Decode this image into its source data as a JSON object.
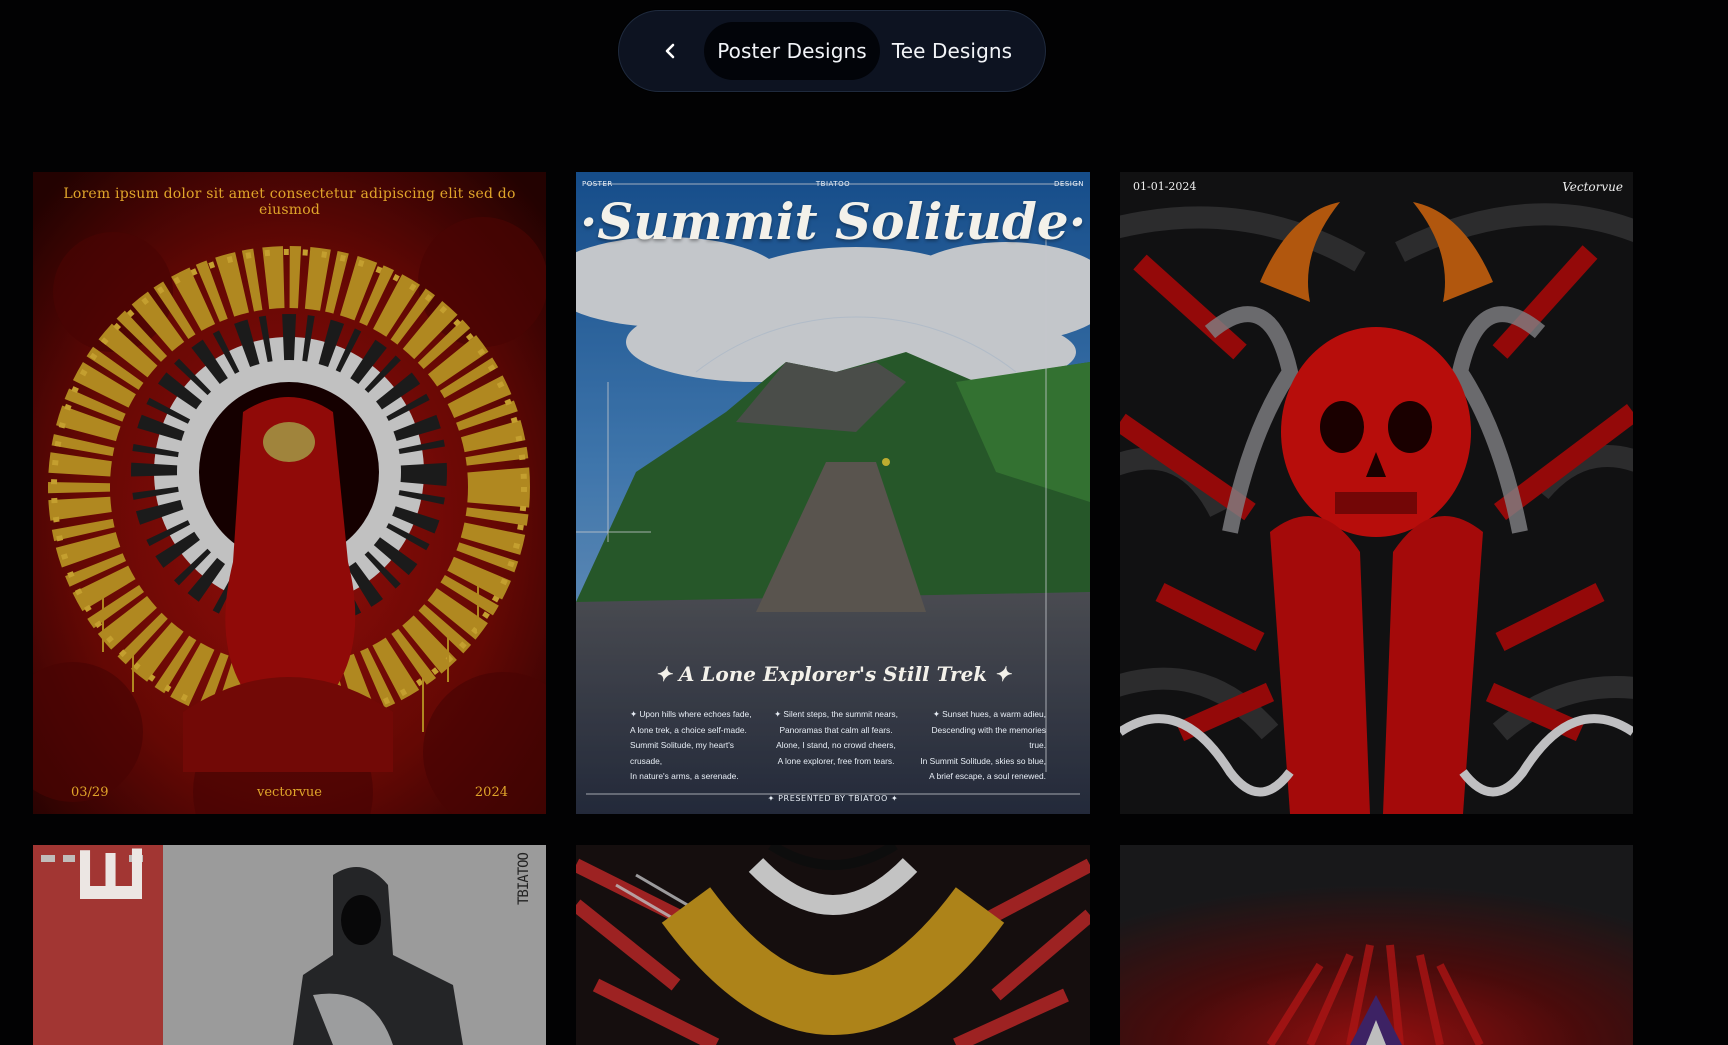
{
  "nav": {
    "back_label": "Back",
    "tabs": [
      {
        "label": "Poster Designs",
        "active": true
      },
      {
        "label": "Tee Designs",
        "active": false
      }
    ]
  },
  "colors": {
    "background": "#020203",
    "pill_bg": "#0d1321",
    "active_tab_bg": "#020409",
    "tab_text": "#f2f4f8"
  },
  "posters": [
    {
      "name": "calligraphy-halo-poster",
      "top_text": "Lorem ipsum dolor sit amet consectetur adipiscing elit sed do eiusmod",
      "footer_left": "03/29",
      "footer_center": "vectorvue",
      "footer_right": "2024"
    },
    {
      "name": "summit-solitude-poster",
      "corner_left": "POSTER",
      "corner_center": "TBIATOO",
      "corner_right": "DESIGN",
      "title": "·Summit Solitude·",
      "subtitle": "✦ A Lone Explorer's Still Trek ✦",
      "verses": [
        "✦ Upon hills where echoes fade,\nA lone trek, a choice self-made.\nSummit Solitude, my heart's\ncrusade,\nIn nature's arms, a serenade.",
        "✦ Silent steps, the summit nears,\nPanoramas that calm all fears.\nAlone, I stand, no crowd cheers,\nA lone explorer, free from tears.",
        "✦ Sunset hues, a warm adieu,\nDescending with the memories\ntrue.\nIn Summit Solitude, skies so blue,\nA brief escape, a soul renewed."
      ],
      "presented": "✦ PRESENTED BY TBIATOO ✦"
    },
    {
      "name": "red-skull-poster",
      "date": "01-01-2024",
      "brand": "Vectorvue"
    },
    {
      "name": "hooded-figure-poster",
      "side_text": "EAR",
      "brand": "TBIATOO"
    },
    {
      "name": "gold-calligraphy-poster"
    },
    {
      "name": "red-texture-poster"
    }
  ]
}
